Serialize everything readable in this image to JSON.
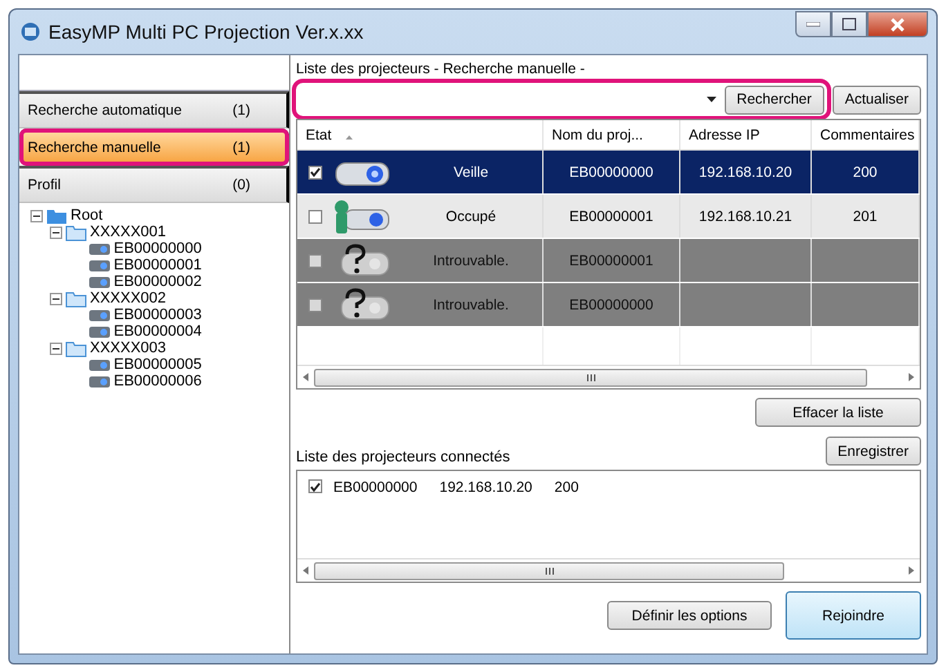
{
  "window": {
    "title": "EasyMP Multi PC Projection Ver.x.xx"
  },
  "nav": [
    {
      "label": "Recherche automatique",
      "count": "(1)",
      "selected": false,
      "highlighted": false
    },
    {
      "label": "Recherche manuelle",
      "count": "(1)",
      "selected": true,
      "highlighted": true
    },
    {
      "label": "Profil",
      "count": "(0)",
      "selected": false,
      "highlighted": false
    }
  ],
  "tree": [
    {
      "label": "Root",
      "kind": "root",
      "expanded": true,
      "children": [
        {
          "label": "XXXXX001",
          "kind": "folder",
          "expanded": true,
          "children": [
            {
              "label": "EB00000000",
              "kind": "projector"
            },
            {
              "label": "EB00000001",
              "kind": "projector"
            },
            {
              "label": "EB00000002",
              "kind": "projector"
            }
          ]
        },
        {
          "label": "XXXXX002",
          "kind": "folder",
          "expanded": true,
          "children": [
            {
              "label": "EB00000003",
              "kind": "projector"
            },
            {
              "label": "EB00000004",
              "kind": "projector"
            }
          ]
        },
        {
          "label": "XXXXX003",
          "kind": "folder",
          "expanded": true,
          "children": [
            {
              "label": "EB00000005",
              "kind": "projector"
            },
            {
              "label": "EB00000006",
              "kind": "projector"
            }
          ]
        }
      ]
    }
  ],
  "search": {
    "heading": "Liste des projecteurs - Recherche manuelle -",
    "highlighted": true,
    "search_button": "Rechercher",
    "refresh_button": "Actualiser"
  },
  "table": {
    "columns": [
      "Etat",
      "Nom du proj...",
      "Adresse IP",
      "Commentaires"
    ],
    "rows": [
      {
        "kind": "standby",
        "checked": true,
        "selected": true,
        "status": "Veille",
        "name": "EB00000000",
        "ip": "192.168.10.20",
        "comment": "200"
      },
      {
        "kind": "busy",
        "checked": false,
        "selected": false,
        "status": "Occupé",
        "name": "EB00000001",
        "ip": "192.168.10.21",
        "comment": "201"
      },
      {
        "kind": "unknown",
        "checked": false,
        "selected": false,
        "status": "Introuvable.",
        "name": "EB00000001"
      },
      {
        "kind": "unknown",
        "checked": false,
        "selected": false,
        "status": "Introuvable.",
        "name": "EB00000000"
      }
    ]
  },
  "clear_button": "Effacer la liste",
  "connected": {
    "heading": "Liste des projecteurs connectés",
    "save_button": "Enregistrer",
    "items": [
      {
        "checked": true,
        "name": "EB00000000",
        "ip": "192.168.10.20",
        "comment": "200"
      }
    ]
  },
  "buttons": [
    {
      "label": "Définir les options",
      "kind": "normal"
    },
    {
      "label": "Rejoindre",
      "kind": "default"
    }
  ]
}
